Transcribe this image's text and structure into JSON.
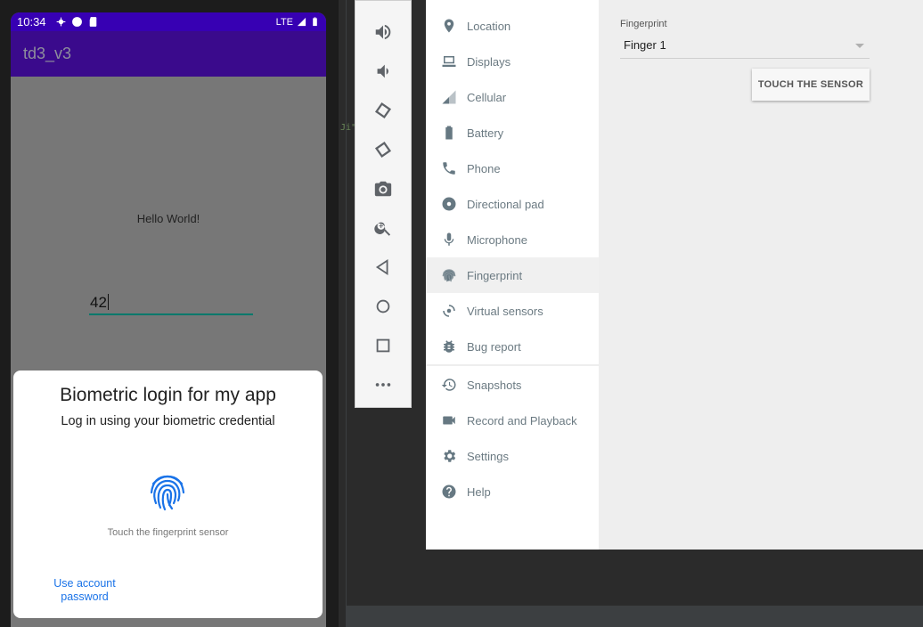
{
  "status_bar": {
    "time": "10:34",
    "network": "LTE"
  },
  "app": {
    "title": "td3_v3",
    "hello_text": "Hello World!",
    "input_value": "42"
  },
  "biometric_dialog": {
    "title": "Biometric login for my app",
    "subtitle": "Log in using your biometric credential",
    "hint": "Touch the fingerprint sensor",
    "alt_action": "Use account password"
  },
  "ide": {
    "code_fragment": "Ji\""
  },
  "toolbar": {
    "buttons": [
      "volume-up-icon",
      "volume-down-icon",
      "rotate-left-icon",
      "rotate-right-icon",
      "camera-icon",
      "zoom-icon",
      "back-icon",
      "home-icon",
      "overview-icon",
      "more-icon"
    ]
  },
  "extended_controls": {
    "nav": [
      {
        "label": "Location",
        "icon": "location-pin-icon"
      },
      {
        "label": "Displays",
        "icon": "laptop-icon"
      },
      {
        "label": "Cellular",
        "icon": "signal-icon"
      },
      {
        "label": "Battery",
        "icon": "battery-icon"
      },
      {
        "label": "Phone",
        "icon": "phone-icon"
      },
      {
        "label": "Directional pad",
        "icon": "dpad-icon"
      },
      {
        "label": "Microphone",
        "icon": "microphone-icon"
      },
      {
        "label": "Fingerprint",
        "icon": "fingerprint-icon",
        "active": true
      },
      {
        "label": "Virtual sensors",
        "icon": "sensors-icon"
      },
      {
        "label": "Bug report",
        "icon": "bug-icon"
      },
      {
        "label": "Snapshots",
        "icon": "history-icon"
      },
      {
        "label": "Record and Playback",
        "icon": "video-camera-icon"
      },
      {
        "label": "Settings",
        "icon": "gear-icon"
      },
      {
        "label": "Help",
        "icon": "help-icon"
      }
    ],
    "fingerprint": {
      "label": "Fingerprint",
      "selected": "Finger 1",
      "touch_button": "TOUCH THE SENSOR"
    }
  },
  "colors": {
    "status_bar": "#3700b3",
    "app_bar": "#3a0a8c",
    "accent": "#00796b",
    "link": "#1a73e8"
  }
}
